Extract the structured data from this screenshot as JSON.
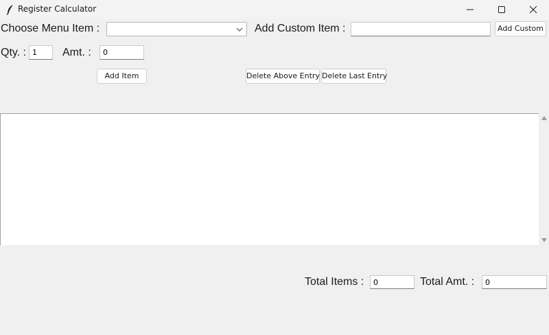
{
  "window": {
    "title": "Register Calculator",
    "icon": "feather-icon"
  },
  "menu": {
    "choose_label": "Choose Menu Item :",
    "selected_value": "",
    "custom_label": "Add Custom Item :",
    "custom_value": "",
    "add_custom_button": "Add Custom"
  },
  "entry": {
    "qty_label": "Qty. :",
    "qty_value": "1",
    "amt_label": "Amt. :",
    "amt_value": "0"
  },
  "actions": {
    "add_item": "Add Item",
    "delete_above": "Delete Above Entry",
    "delete_last": "Delete Last Entry"
  },
  "log": {
    "content": ""
  },
  "totals": {
    "items_label": "Total Items :",
    "items_value": "0",
    "amt_label": "Total Amt. :",
    "amt_value": "0"
  }
}
